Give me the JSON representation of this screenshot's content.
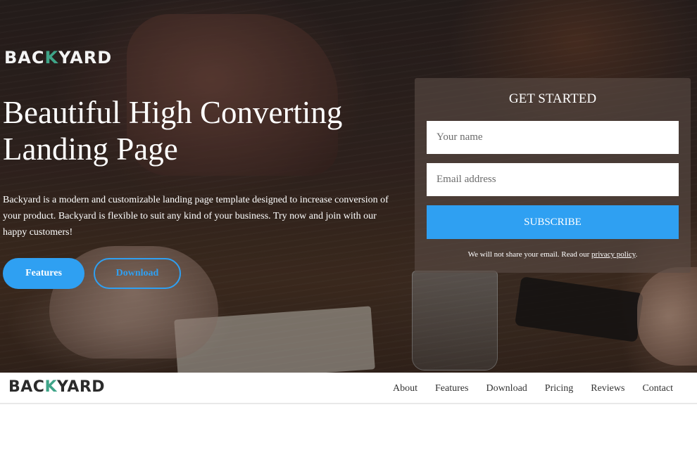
{
  "hero": {
    "logo": {
      "text_before": "BAC",
      "highlight": "K",
      "text_after": "YARD"
    },
    "title": "Beautiful High Converting Landing Page",
    "description": "Backyard is a modern and customizable landing page template designed to increase conversion of your product. Backyard is flexible to suit any kind of your business. Try now and join with our happy customers!",
    "buttons": {
      "features": "Features",
      "download": "Download"
    }
  },
  "signup": {
    "title": "GET STARTED",
    "name_placeholder": "Your name",
    "email_placeholder": "Email address",
    "submit_label": "SUBSCRIBE",
    "note_prefix": "We will not share your email. Read our ",
    "privacy_link": "privacy policy",
    "note_suffix": "."
  },
  "navbar": {
    "logo": {
      "text_before": "BAC",
      "highlight": "K",
      "text_after": "YARD"
    },
    "links": [
      "About",
      "Features",
      "Download",
      "Pricing",
      "Reviews",
      "Contact"
    ]
  },
  "colors": {
    "accent": "#2fa0f2",
    "logo_highlight": "#3fa488"
  }
}
